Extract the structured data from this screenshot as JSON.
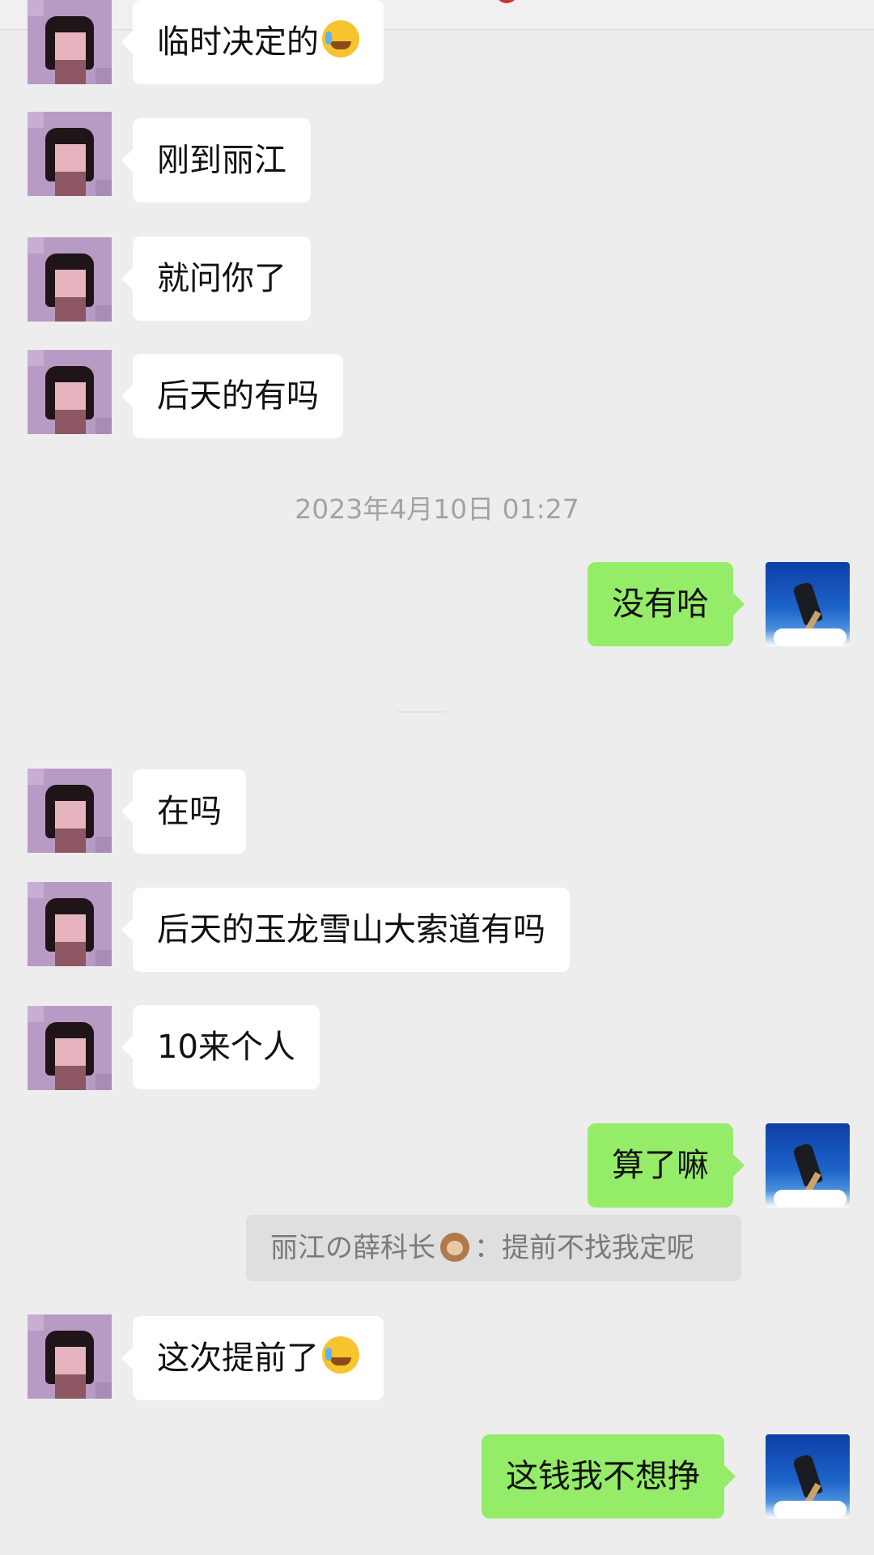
{
  "colors": {
    "background": "#ededed",
    "incoming_bubble": "#ffffff",
    "outgoing_bubble": "#95ec69",
    "timestamp_text": "#a3a3a3"
  },
  "messages": [
    {
      "side": "incoming",
      "text": "临时决定的",
      "emoji": "crying-laughing-emoji"
    },
    {
      "side": "incoming",
      "text": "刚到丽江"
    },
    {
      "side": "incoming",
      "text": "就问你了"
    },
    {
      "side": "incoming",
      "text": "后天的有吗"
    },
    {
      "side": "outgoing",
      "text": "没有哈"
    },
    {
      "side": "incoming",
      "text": "在吗"
    },
    {
      "side": "incoming",
      "text": "后天的玉龙雪山大索道有吗"
    },
    {
      "side": "incoming",
      "text": "10来个人"
    },
    {
      "side": "outgoing",
      "text": "算了嘛"
    },
    {
      "side": "incoming",
      "text": "这次提前了",
      "emoji": "crying-laughing-emoji"
    },
    {
      "side": "outgoing",
      "text": "这钱我不想挣"
    }
  ],
  "timestamp": "2023年4月10日 01:27",
  "quote": {
    "sender": "丽江の薛科长",
    "sender_emoji": "monkey-emoji",
    "separator": "：",
    "text": "提前不找我定呢"
  }
}
